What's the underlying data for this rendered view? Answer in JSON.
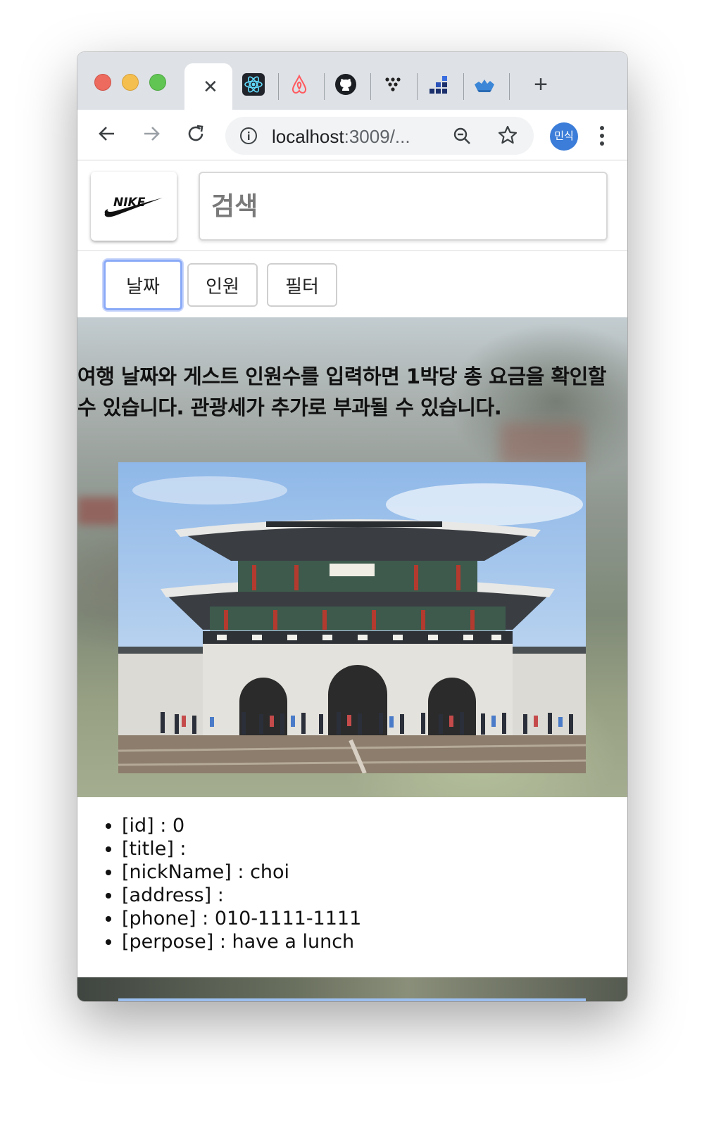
{
  "browser": {
    "active_tab": {
      "close_glyph": "✕"
    },
    "pinned_tabs": [
      {
        "icon": "react-icon"
      },
      {
        "icon": "airbnb-icon"
      },
      {
        "icon": "github-icon"
      },
      {
        "icon": "toss-icon"
      },
      {
        "icon": "chart-blocks-icon"
      },
      {
        "icon": "boat-icon"
      }
    ],
    "new_tab_glyph": "+",
    "url_host": "localhost",
    "url_rest": ":3009/...",
    "profile_label": "민식"
  },
  "header": {
    "logo_text": "NIKE",
    "search_placeholder": "검색"
  },
  "filters": [
    {
      "label": "날짜",
      "active": true
    },
    {
      "label": "인원",
      "active": false
    },
    {
      "label": "필터",
      "active": false
    }
  ],
  "hero": {
    "text": "여행 날짜와 게스트 인원수를 입력하면 1박당 총 요금을 확인할 수 있습니다. 관광세가 추가로 부과될 수 있습니다."
  },
  "details": [
    "[id] : 0",
    "[title] :",
    "[nickName] : choi",
    "[address] :",
    "[phone] : 010-1111-1111",
    "[perpose] : have a lunch"
  ],
  "colors": {
    "focus_ring": "#8aaaf7",
    "profile_bg": "#3b7dd8"
  }
}
